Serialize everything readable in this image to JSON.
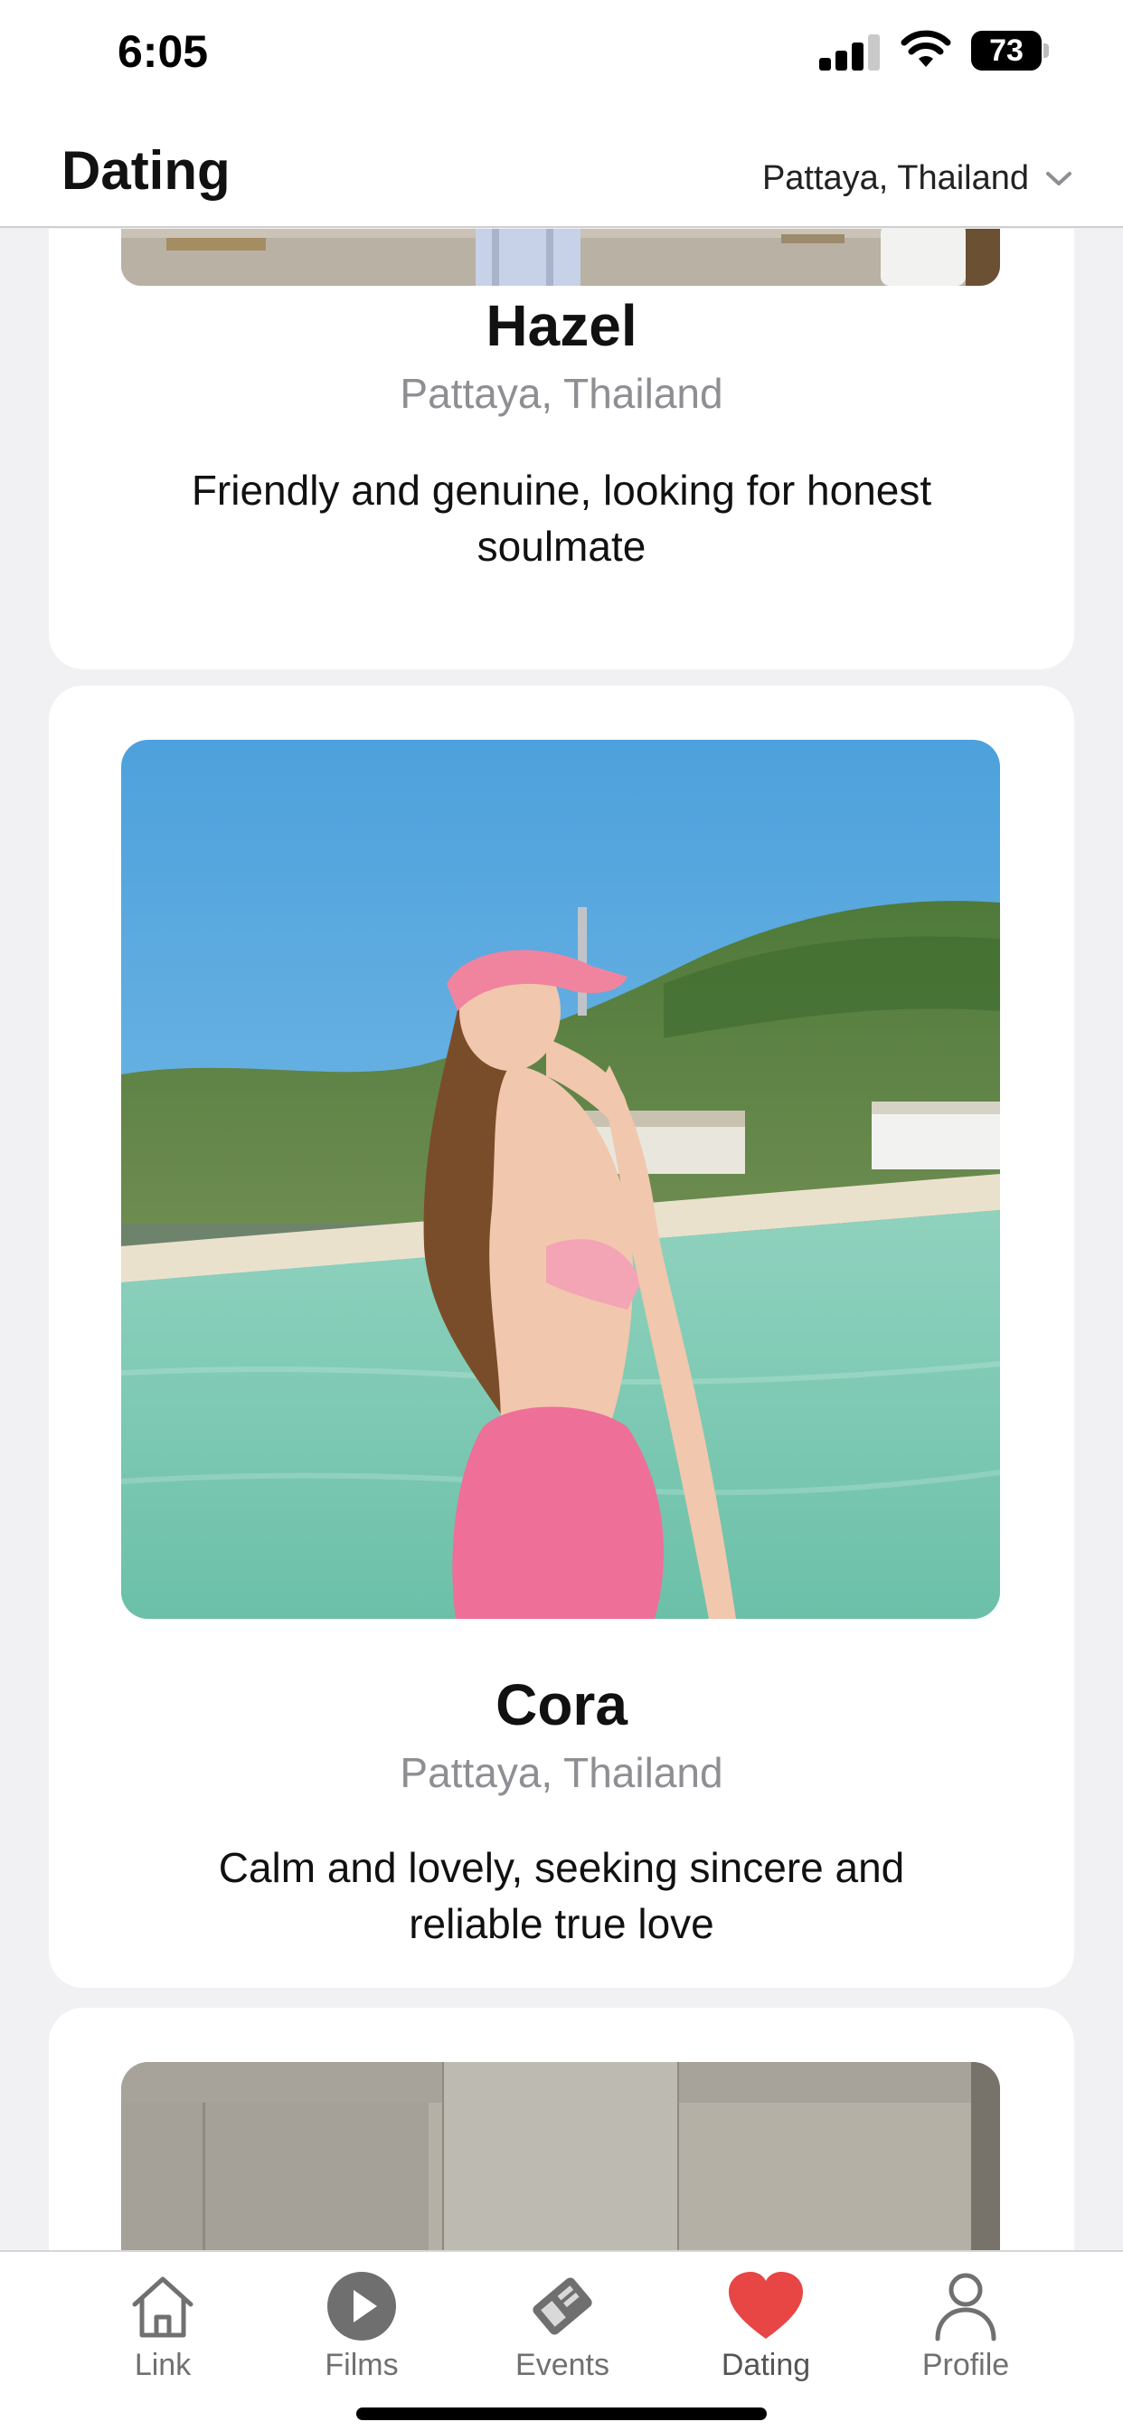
{
  "status_bar": {
    "time": "6:05",
    "battery": "73"
  },
  "header": {
    "title": "Dating",
    "location": "Pattaya, Thailand"
  },
  "profiles": [
    {
      "name": "Hazel",
      "location": "Pattaya, Thailand",
      "bio_line1": "Friendly and genuine, looking for honest",
      "bio_line2": "soulmate"
    },
    {
      "name": "Cora",
      "location": "Pattaya, Thailand",
      "bio_line1": "Calm and lovely, seeking sincere and",
      "bio_line2": "reliable true love"
    },
    {
      "name": "",
      "location": "",
      "bio_line1": "",
      "bio_line2": ""
    }
  ],
  "tabs": [
    {
      "label": "Link",
      "icon": "home-icon"
    },
    {
      "label": "Films",
      "icon": "play-icon"
    },
    {
      "label": "Events",
      "icon": "ticket-icon"
    },
    {
      "label": "Dating",
      "icon": "heart-icon",
      "active": true
    },
    {
      "label": "Profile",
      "icon": "person-icon"
    }
  ],
  "colors": {
    "accent": "#e84545",
    "card": "#ffffff",
    "background": "#f1f1f3"
  }
}
